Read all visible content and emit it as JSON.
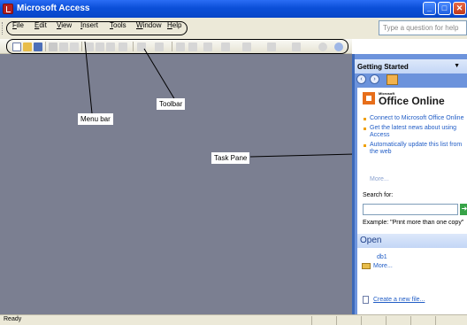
{
  "window": {
    "title": "Microsoft Access",
    "controls": [
      "_",
      "□",
      "✕"
    ]
  },
  "menubar": {
    "items": [
      "File",
      "Edit",
      "View",
      "Insert",
      "Tools",
      "Window",
      "Help"
    ],
    "question_placeholder": "Type a question for help"
  },
  "toolbar": {
    "buttons": [
      "new-icon",
      "open-icon",
      "save-icon",
      "print-icon",
      "spelling-icon",
      "cut-icon",
      "copy-icon",
      "paste-icon",
      "undo-icon",
      "office-links-icon",
      "analyze-icon",
      "code-icon",
      "properties-icon",
      "relationships-icon",
      "new-object-icon",
      "help-icon"
    ]
  },
  "annotations": {
    "menu_bar": "Menu bar",
    "toolbar": "Toolbar",
    "task_pane": "Task Pane"
  },
  "task_pane": {
    "title": "Getting Started",
    "office_brand_small": "Microsoft",
    "office_brand": "Office Online",
    "links": [
      "Connect to Microsoft Office Online",
      "Get the latest news about using Access",
      "Automatically update this list from the web"
    ],
    "more": "More...",
    "search_label": "Search for:",
    "search_value": "",
    "example": "Example: \"Print more than one copy\"",
    "open_title": "Open",
    "open_files": [
      "db1"
    ],
    "open_more": "More...",
    "create_new": "Create a new file..."
  },
  "statusbar": {
    "text": "Ready"
  },
  "colors": {
    "titlebar": "#0b4fd8",
    "workspace": "#7b7f91",
    "taskpane": "#6c93dc",
    "link": "#215dc6"
  }
}
